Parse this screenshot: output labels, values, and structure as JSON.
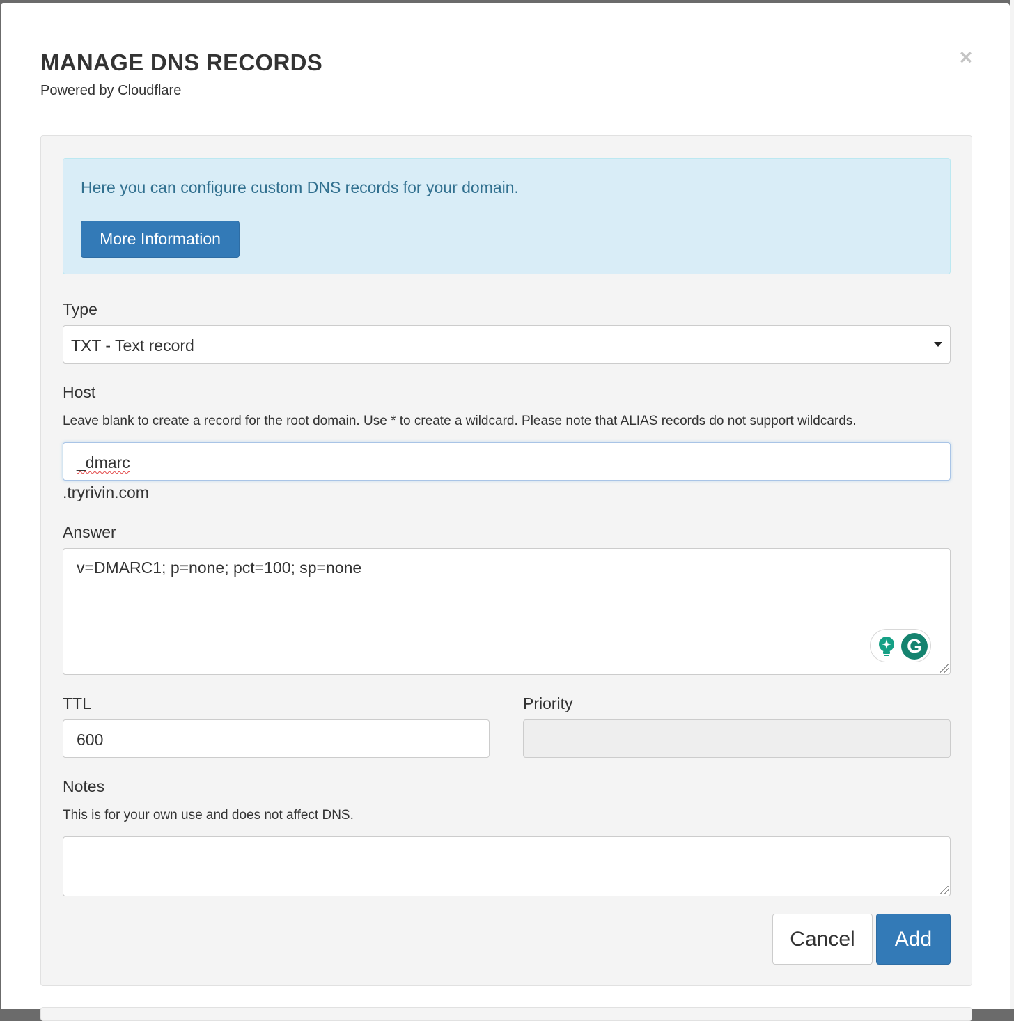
{
  "modal": {
    "title": "MANAGE DNS RECORDS",
    "subtitle": "Powered by Cloudflare",
    "close_label": "×"
  },
  "alert": {
    "text": "Here you can configure custom DNS records for your domain.",
    "button_label": "More Information"
  },
  "type_field": {
    "label": "Type",
    "selected": "TXT - Text record"
  },
  "host_field": {
    "label": "Host",
    "help": "Leave blank to create a record for the root domain. Use * to create a wildcard. Please note that ALIAS records do not support wildcards.",
    "value": "_dmarc",
    "suffix": ".tryrivin.com"
  },
  "answer_field": {
    "label": "Answer",
    "value": "v=DMARC1; p=none; pct=100; sp=none"
  },
  "ttl_field": {
    "label": "TTL",
    "value": "600"
  },
  "priority_field": {
    "label": "Priority",
    "value": ""
  },
  "notes_field": {
    "label": "Notes",
    "help": "This is for your own use and does not affect DNS.",
    "value": ""
  },
  "actions": {
    "cancel_label": "Cancel",
    "add_label": "Add"
  },
  "extension": {
    "logo_letter": "G"
  },
  "colors": {
    "primary": "#337ab7",
    "alert_bg": "#d9edf7",
    "alert_text": "#31708f",
    "grammarly": "#15836f"
  }
}
